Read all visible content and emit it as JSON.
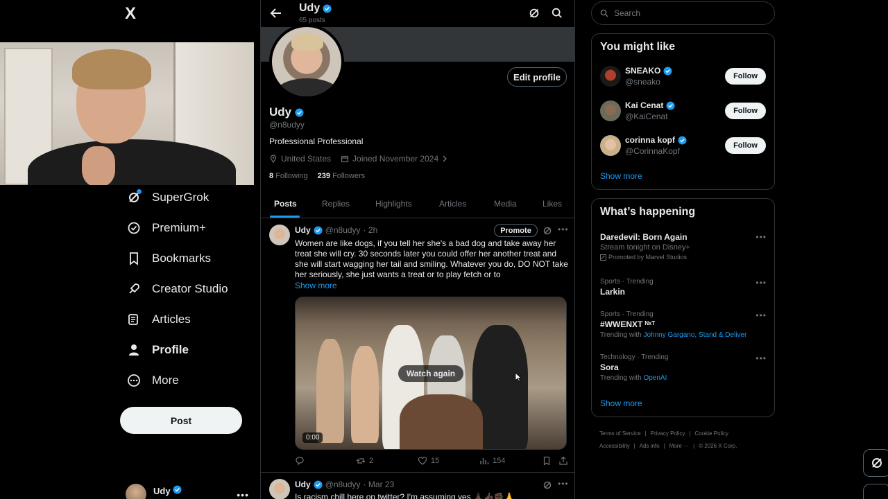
{
  "app": {
    "logo": "X"
  },
  "nav": {
    "items": [
      {
        "label": "SuperGrok",
        "icon": "grok-icon"
      },
      {
        "label": "Premium+",
        "icon": "verified-badge-icon"
      },
      {
        "label": "Bookmarks",
        "icon": "bookmark-icon"
      },
      {
        "label": "Creator Studio",
        "icon": "rocket-icon"
      },
      {
        "label": "Articles",
        "icon": "article-icon"
      },
      {
        "label": "Profile",
        "icon": "person-icon"
      },
      {
        "label": "More",
        "icon": "more-circle-icon"
      }
    ],
    "post_label": "Post",
    "account_name": "Udy"
  },
  "header": {
    "title": "Udy",
    "posts_count": "65 posts"
  },
  "profile": {
    "edit_label": "Edit profile",
    "name": "Udy",
    "handle": "@n8udyy",
    "bio": "Professional Professional",
    "location": "United States",
    "joined": "Joined November 2024",
    "following_count": "8",
    "following_label": "Following",
    "followers_count": "239",
    "followers_label": "Followers"
  },
  "tabs": [
    "Posts",
    "Replies",
    "Highlights",
    "Articles",
    "Media",
    "Likes"
  ],
  "tweet1": {
    "name": "Udy",
    "handle": "@n8udyy",
    "time": "· 2h",
    "promote": "Promote",
    "text": "Women are like dogs, if you tell her she's a bad dog and take away her treat she will cry. 30 seconds later you could offer her another treat and she will start wagging her tail and smiling. Whatever you do, DO NOT take her seriously, she just wants a treat or to play fetch or to",
    "show_more": "Show more",
    "watch_again": "Watch again",
    "timecode": "0:00",
    "retweets": "2",
    "likes": "15",
    "views": "154"
  },
  "tweet2": {
    "name": "Udy",
    "handle": "@n8udyy",
    "time": "· Mar 23",
    "text": "Is racism chill here on twitter? I'm assuming yes 🙏🏿👍🏿✊🏿🙏"
  },
  "search": {
    "placeholder": "Search"
  },
  "who_to_follow": {
    "title": "You might like",
    "users": [
      {
        "name": "SNEAKO",
        "handle": "@sneako",
        "button": "Follow"
      },
      {
        "name": "Kai Cenat",
        "handle": "@KaiCenat",
        "button": "Follow"
      },
      {
        "name": "corinna kopf",
        "handle": "@CorinnaKopf",
        "button": "Follow"
      }
    ],
    "show_more": "Show more"
  },
  "happening": {
    "title": "What’s happening",
    "promo": {
      "title": "Daredevil: Born Again",
      "subtitle": "Stream tonight on Disney+",
      "promoted": "Promoted by Marvel Studios"
    },
    "trends": [
      {
        "context": "Sports · Trending",
        "title": "Larkin",
        "with_label": "",
        "with": ""
      },
      {
        "context": "Sports · Trending",
        "title": "#WWENXT ᴺˣᵀ",
        "with_label": "Trending with",
        "with": "Johnny Gargano, Stand & Deliver"
      },
      {
        "context": "Technology · Trending",
        "title": "Sora",
        "with_label": "Trending with",
        "with": "OpenAI"
      }
    ],
    "show_more": "Show more"
  },
  "footer": {
    "links": [
      "Terms of Service",
      "Privacy Policy",
      "Cookie Policy",
      "Accessibility",
      "Ads info",
      "More ···"
    ],
    "copyright": "© 2026 X Corp."
  },
  "colors": {
    "accent": "#1d9bf0",
    "bg": "#000000",
    "border": "#2f3336",
    "muted": "#71767b"
  }
}
